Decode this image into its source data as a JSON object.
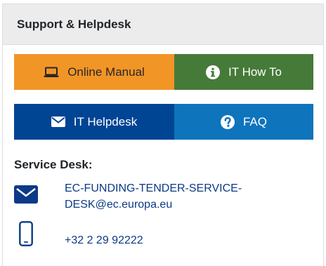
{
  "header": {
    "title": "Support & Helpdesk"
  },
  "buttons": {
    "manual": {
      "label": "Online Manual",
      "icon": "laptop-icon",
      "color": "#f29527"
    },
    "howto": {
      "label": "IT How To",
      "icon": "info-circle-icon",
      "color": "#467a39"
    },
    "helpdesk": {
      "label": "IT Helpdesk",
      "icon": "envelope-icon",
      "color": "#004494"
    },
    "faq": {
      "label": "FAQ",
      "icon": "question-circle-icon",
      "color": "#0e74bc"
    }
  },
  "service_desk": {
    "title": "Service Desk:",
    "email_line1": "EC-FUNDING-TENDER-SERVICE-",
    "email_line2": "DESK@ec.europa.eu",
    "email_icon": "envelope-icon",
    "phone": "+32 2 29 92222",
    "phone_icon": "mobile-phone-icon"
  }
}
